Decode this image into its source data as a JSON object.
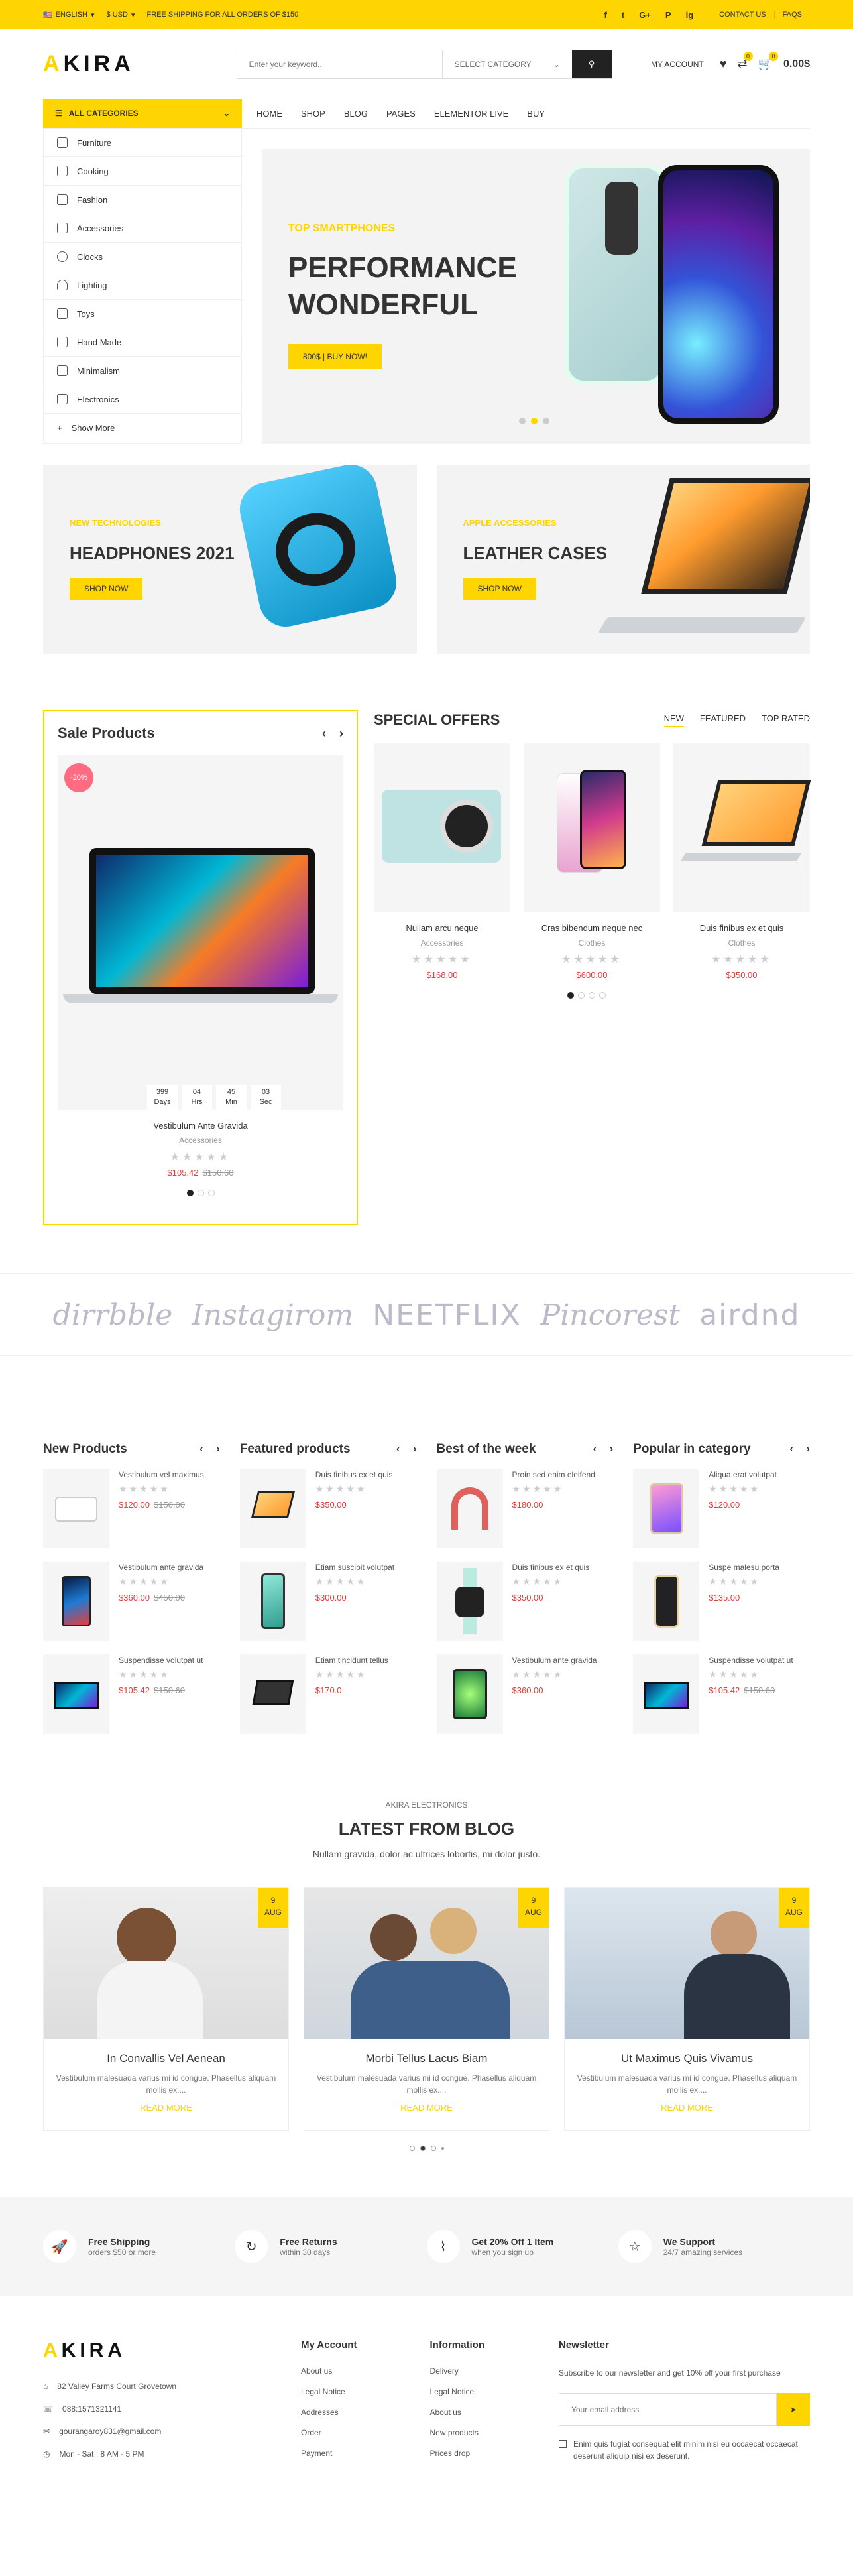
{
  "topbar": {
    "language": "ENGLISH",
    "currency": "$ USD",
    "shipping": "FREE SHIPPING FOR ALL ORDERS OF $150",
    "social": [
      "f",
      "t",
      "G+",
      "P",
      "ig"
    ],
    "contact": "CONTACT US",
    "faqs": "FAQS"
  },
  "header": {
    "logo_a": "A",
    "logo_rest": "KIRA",
    "search_placeholder": "Enter your keyword...",
    "category_select": "SELECT CATEGORY",
    "account": "MY ACCOUNT",
    "compare_count": "0",
    "cart_count": "0",
    "cart_total": "0.00$"
  },
  "nav": {
    "all_categories": "ALL CATEGORIES",
    "links": [
      "HOME",
      "SHOP",
      "BLOG",
      "PAGES",
      "ELEMENTOR LIVE",
      "BUY"
    ]
  },
  "categories": [
    "Furniture",
    "Cooking",
    "Fashion",
    "Accessories",
    "Clocks",
    "Lighting",
    "Toys",
    "Hand Made",
    "Minimalism",
    "Electronics",
    "Show More"
  ],
  "slider": {
    "subtitle": "TOP SMARTPHONES",
    "title": "PERFORMANCE WONDERFUL",
    "button": "800$ | BUY NOW!"
  },
  "banners": [
    {
      "subtitle": "NEW TECHNOLOGIES",
      "title": "HEADPHONES 2021",
      "button": "SHOP NOW"
    },
    {
      "subtitle": "APPLE ACCESSORIES",
      "title": "LEATHER CASES",
      "button": "SHOP NOW"
    }
  ],
  "sale": {
    "heading": "Sale Products",
    "discount": "-20%",
    "timer": [
      {
        "v": "399",
        "l": "Days"
      },
      {
        "v": "04",
        "l": "Hrs"
      },
      {
        "v": "45",
        "l": "Min"
      },
      {
        "v": "03",
        "l": "Sec"
      }
    ],
    "name": "Vestibulum Ante Gravida",
    "category": "Accessories",
    "price": "$105.42",
    "old_price": "$150.60"
  },
  "special": {
    "heading": "SPECIAL OFFERS",
    "tabs": [
      "NEW",
      "FEATURED",
      "TOP RATED"
    ],
    "items": [
      {
        "name": "Nullam arcu neque",
        "category": "Accessories",
        "price": "$168.00"
      },
      {
        "name": "Cras bibendum neque nec",
        "category": "Clothes",
        "price": "$600.00"
      },
      {
        "name": "Duis finibus ex et quis",
        "category": "Clothes",
        "price": "$350.00"
      }
    ]
  },
  "brands": [
    "dirrbble",
    "Instagirom",
    "NEETFLIX",
    "Pincorest",
    "airdnd"
  ],
  "lists": [
    {
      "title": "New Products",
      "items": [
        {
          "name": "Vestibulum vel maximus",
          "price": "$120.00",
          "old": "$150.00"
        },
        {
          "name": "Vestibulum ante gravida",
          "price": "$360.00",
          "old": "$450.00"
        },
        {
          "name": "Suspendisse volutpat ut",
          "price": "$105.42",
          "old": "$150.60"
        }
      ]
    },
    {
      "title": "Featured products",
      "items": [
        {
          "name": "Duis finibus ex et quis",
          "price": "$350.00",
          "old": ""
        },
        {
          "name": "Etiam suscipit volutpat",
          "price": "$300.00",
          "old": ""
        },
        {
          "name": "Etiam tincidunt tellus",
          "price": "$170.0",
          "old": ""
        }
      ]
    },
    {
      "title": "Best of the week",
      "items": [
        {
          "name": "Proin sed enim eleifend",
          "price": "$180.00",
          "old": ""
        },
        {
          "name": "Duis finibus ex et quis",
          "price": "$350.00",
          "old": ""
        },
        {
          "name": "Vestibulum ante gravida",
          "price": "$360.00",
          "old": ""
        }
      ]
    },
    {
      "title": "Popular in category",
      "items": [
        {
          "name": "Aliqua erat volutpat",
          "price": "$120.00",
          "old": ""
        },
        {
          "name": "Suspe malesu porta",
          "price": "$135.00",
          "old": ""
        },
        {
          "name": "Suspendisse volutpat ut",
          "price": "$105.42",
          "old": "$150.60"
        }
      ]
    }
  ],
  "blog": {
    "subtitle": "AKIRA ELECTRONICS",
    "title": "LATEST FROM BLOG",
    "description": "Nullam gravida, dolor ac ultrices lobortis, mi dolor justo.",
    "posts": [
      {
        "day": "9",
        "month": "AUG",
        "title": "In Convallis Vel Aenean",
        "excerpt": "Vestibulum malesuada varius mi id congue. Phasellus aliquam mollis ex....",
        "more": "READ MORE"
      },
      {
        "day": "9",
        "month": "AUG",
        "title": "Morbi Tellus Lacus Biam",
        "excerpt": "Vestibulum malesuada varius mi id congue. Phasellus aliquam mollis ex....",
        "more": "READ MORE"
      },
      {
        "day": "9",
        "month": "AUG",
        "title": "Ut Maximus Quis Vivamus",
        "excerpt": "Vestibulum malesuada varius mi id congue. Phasellus aliquam mollis ex....",
        "more": "READ MORE"
      }
    ]
  },
  "services": [
    {
      "title": "Free Shipping",
      "text": "orders $50 or more"
    },
    {
      "title": "Free Returns",
      "text": "within 30 days"
    },
    {
      "title": "Get 20% Off 1 Item",
      "text": "when you sign up"
    },
    {
      "title": "We Support",
      "text": "24/7 amazing services"
    }
  ],
  "footer": {
    "address": "82 Valley Farms Court Grovetown",
    "phone": "088:1571321141",
    "email": "gourangaroy831@gmail.com",
    "hours": "Mon - Sat : 8 AM - 5 PM",
    "account_title": "My Account",
    "account_links": [
      "About us",
      "Legal Notice",
      "Addresses",
      "Order",
      "Payment"
    ],
    "info_title": "Information",
    "info_links": [
      "Delivery",
      "Legal Notice",
      "About us",
      "New products",
      "Prices drop"
    ],
    "news_title": "Newsletter",
    "news_text": "Subscribe to our newsletter and get 10% off your first purchase",
    "news_placeholder": "Your email address",
    "agree": "Enim quis fugiat consequat elit minim nisi eu occaecat occaecat deserunt aliquip nisi ex deserunt."
  },
  "colors": {
    "accent": "#ffd500",
    "price": "#e43d3d"
  }
}
